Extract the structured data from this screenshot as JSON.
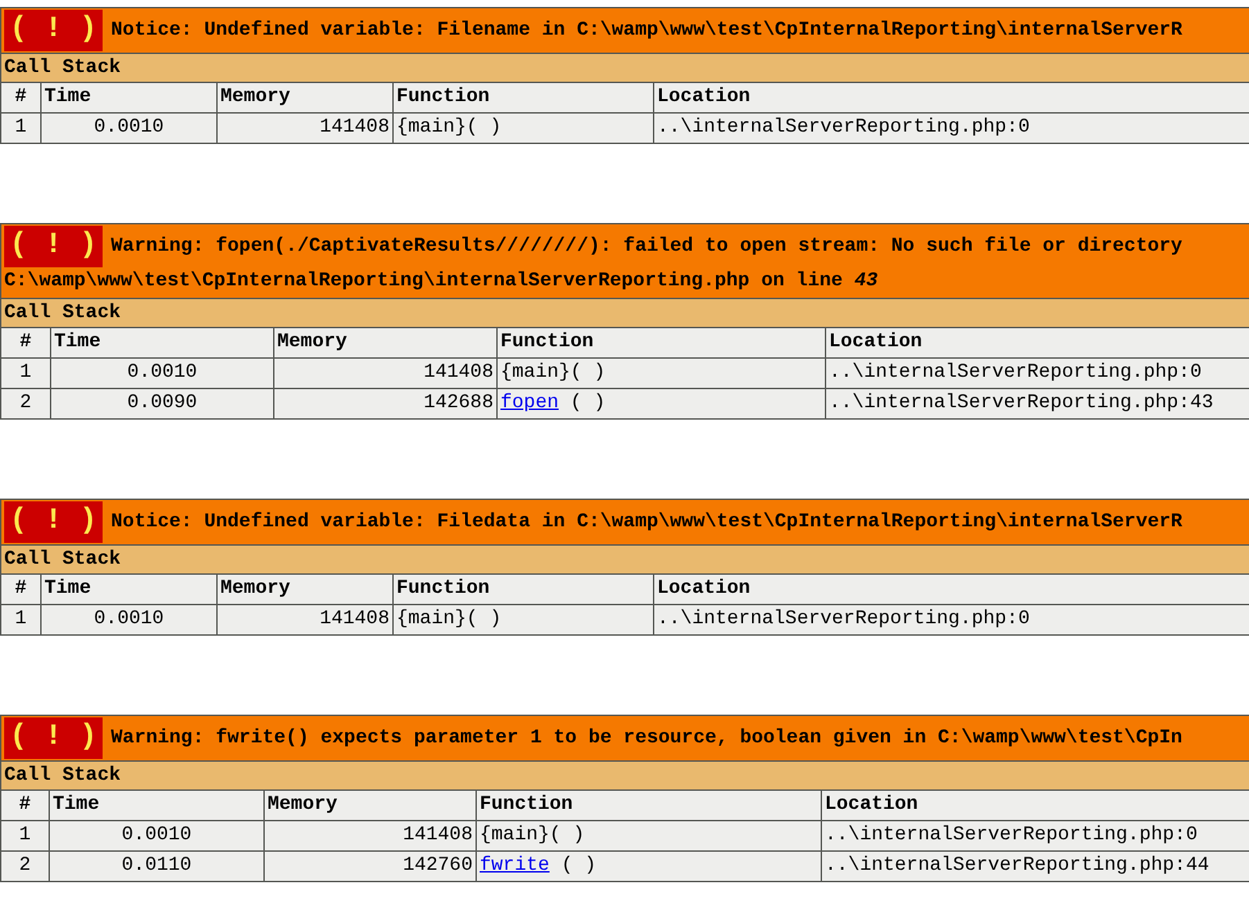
{
  "errors": [
    {
      "badge": "( ! )",
      "message": [
        "Notice: Undefined variable: Filename in C:\\wamp\\www\\test\\CpInternalReporting\\internalServerR"
      ],
      "call_stack_title": "Call Stack",
      "columns": [
        "#",
        "Time",
        "Memory",
        "Function",
        "Location"
      ],
      "rows": [
        {
          "num": "1",
          "time": "0.0010",
          "memory": "141408",
          "function": {
            "name": "{main}( )",
            "link": false
          },
          "location": "..\\internalServerReporting.php:0"
        }
      ]
    },
    {
      "badge": "( ! )",
      "message": [
        "Warning: fopen(./CaptivateResults////////): failed to open stream: No such file or directory",
        "C:\\wamp\\www\\test\\CpInternalReporting\\internalServerReporting.php on line *43*"
      ],
      "call_stack_title": "Call Stack",
      "columns": [
        "#",
        "Time",
        "Memory",
        "Function",
        "Location"
      ],
      "rows": [
        {
          "num": "1",
          "time": "0.0010",
          "memory": "141408",
          "function": {
            "name": "{main}( )",
            "link": false
          },
          "location": "..\\internalServerReporting.php:0"
        },
        {
          "num": "2",
          "time": "0.0090",
          "memory": "142688",
          "function": {
            "name": "fopen",
            "link": true,
            "rest": " ( )"
          },
          "location": "..\\internalServerReporting.php:43"
        }
      ]
    },
    {
      "badge": "( ! )",
      "message": [
        "Notice: Undefined variable: Filedata in C:\\wamp\\www\\test\\CpInternalReporting\\internalServerR"
      ],
      "call_stack_title": "Call Stack",
      "columns": [
        "#",
        "Time",
        "Memory",
        "Function",
        "Location"
      ],
      "rows": [
        {
          "num": "1",
          "time": "0.0010",
          "memory": "141408",
          "function": {
            "name": "{main}( )",
            "link": false
          },
          "location": "..\\internalServerReporting.php:0"
        }
      ]
    },
    {
      "badge": "( ! )",
      "message": [
        "Warning: fwrite() expects parameter 1 to be resource, boolean given in C:\\wamp\\www\\test\\CpIn"
      ],
      "call_stack_title": "Call Stack",
      "columns": [
        "#",
        "Time",
        "Memory",
        "Function",
        "Location"
      ],
      "rows": [
        {
          "num": "1",
          "time": "0.0010",
          "memory": "141408",
          "function": {
            "name": "{main}( )",
            "link": false
          },
          "location": "..\\internalServerReporting.php:0"
        },
        {
          "num": "2",
          "time": "0.0110",
          "memory": "142760",
          "function": {
            "name": "fwrite",
            "link": true,
            "rest": " ( )"
          },
          "location": "..\\internalServerReporting.php:44"
        }
      ]
    }
  ]
}
